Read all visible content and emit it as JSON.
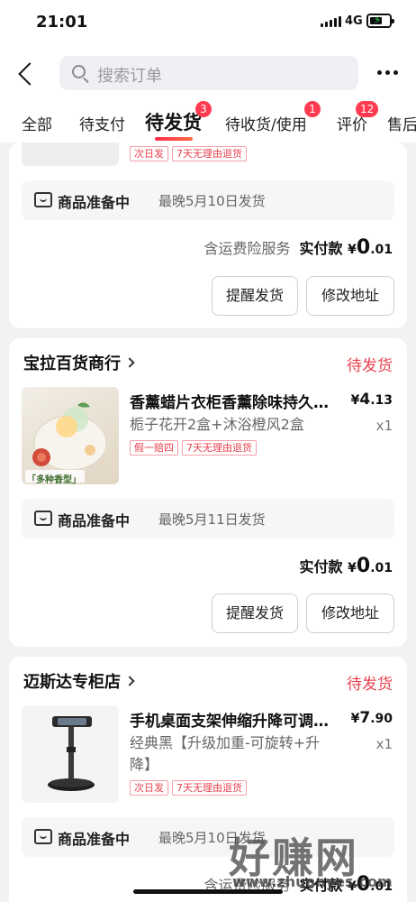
{
  "status_bar": {
    "time": "21:01",
    "network": "4G"
  },
  "search": {
    "placeholder": "搜索订单"
  },
  "tabs": [
    {
      "label": "全部"
    },
    {
      "label": "待支付"
    },
    {
      "label": "待发货",
      "badge": "3",
      "active": true
    },
    {
      "label": "待收货/使用",
      "badge": "1"
    },
    {
      "label": "评价",
      "badge": "12"
    },
    {
      "label": "售后"
    }
  ],
  "orders": [
    {
      "tags": [
        "次日发",
        "7天无理由退货"
      ],
      "shipping": {
        "status": "商品准备中",
        "eta": "最晚5月10日发货"
      },
      "insurance": "含运费险服务",
      "paid_label": "实付款",
      "currency": "¥",
      "amount_int": "0",
      "amount_dec": ".01",
      "buttons": [
        "提醒发货",
        "修改地址"
      ]
    },
    {
      "shop": "宝拉百货商行",
      "status": "待发货",
      "product": "香薰蜡片衣柜香薰除味持久…",
      "price_symbol": "¥",
      "price_int": "4",
      "price_dec": ".13",
      "sku": "栀子花开2盒+沐浴橙风2盒",
      "qty": "x1",
      "tags": [
        "假一赔四",
        "7天无理由退货"
      ],
      "thumb_caption": "「多种香型」",
      "shipping": {
        "status": "商品准备中",
        "eta": "最晚5月11日发货"
      },
      "paid_label": "实付款",
      "currency": "¥",
      "amount_int": "0",
      "amount_dec": ".01",
      "buttons": [
        "提醒发货",
        "修改地址"
      ]
    },
    {
      "shop": "迈斯达专柜店",
      "status": "待发货",
      "product": "手机桌面支架伸缩升降可调…",
      "price_symbol": "¥",
      "price_int": "7",
      "price_dec": ".90",
      "sku": "经典黑【升级加重-可旋转+升降】",
      "qty": "x1",
      "tags": [
        "次日发",
        "7天无理由退货"
      ],
      "shipping": {
        "status": "商品准备中",
        "eta": "最晚5月10日发货"
      },
      "insurance": "含运费险服务",
      "paid_label": "实付款",
      "currency": "¥",
      "amount_int": "0",
      "amount_dec": ".01"
    }
  ],
  "watermark": {
    "text": "好赚网",
    "url": "www.zhuanyes.com"
  },
  "colors": {
    "accent": "#e8414d",
    "badge": "#ff3b50",
    "tag_border": "#f2a0a8"
  }
}
